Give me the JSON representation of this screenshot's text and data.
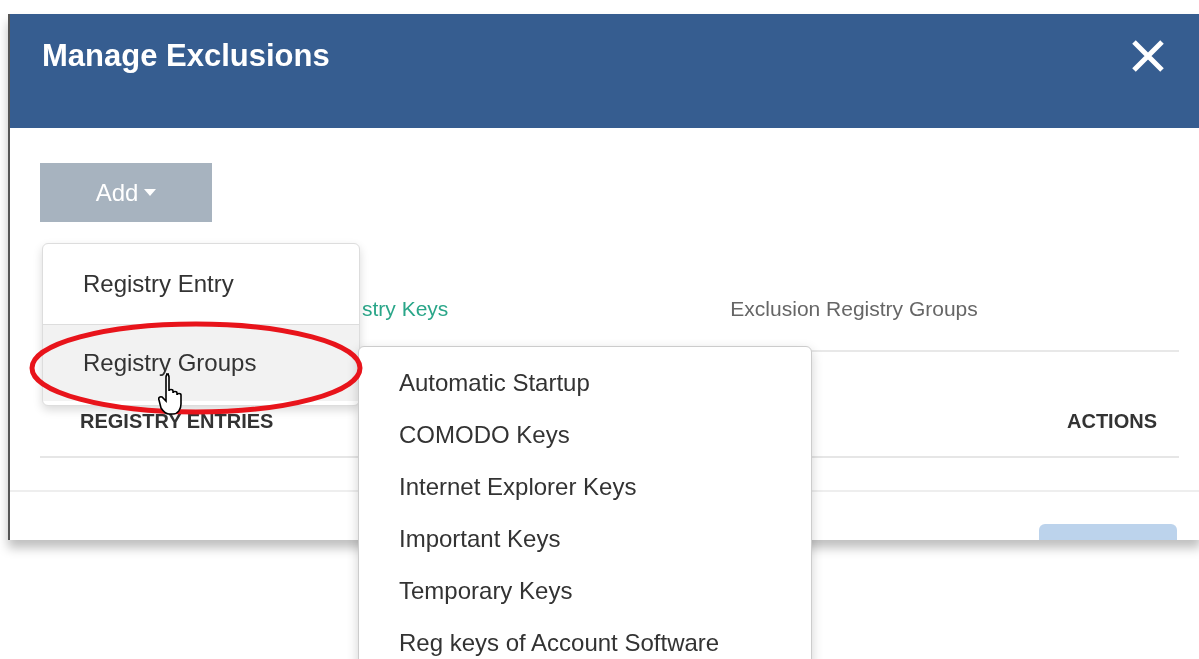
{
  "dialog": {
    "title": "Manage Exclusions"
  },
  "add_button": {
    "label": "Add"
  },
  "tabs": [
    {
      "label": "stry Keys",
      "selected": true
    },
    {
      "label": "Exclusion Registry Groups",
      "selected": false
    }
  ],
  "table": {
    "columns": [
      "REGISTRY ENTRIES",
      "ACTIONS"
    ]
  },
  "add_menu": [
    {
      "label": "Registry Entry",
      "selected": false
    },
    {
      "label": "Registry Groups",
      "selected": true
    }
  ],
  "submenu": [
    {
      "label": "Automatic Startup"
    },
    {
      "label": "COMODO Keys"
    },
    {
      "label": "Internet Explorer Keys"
    },
    {
      "label": "Important Keys"
    },
    {
      "label": "Temporary Keys"
    },
    {
      "label": "Reg keys of Account Software"
    }
  ]
}
